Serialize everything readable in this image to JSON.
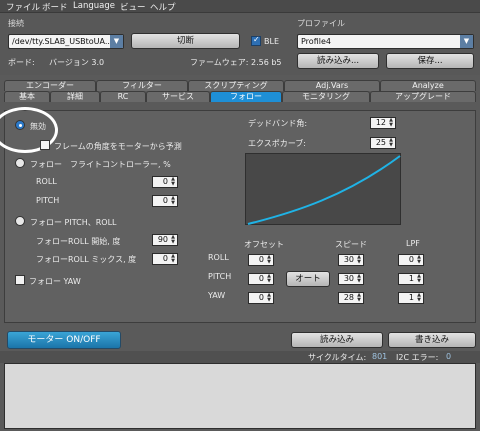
{
  "menu": [
    "ファイル",
    "ボード",
    "Language",
    "ビュー",
    "ヘルプ"
  ],
  "connection": {
    "group_label": "接続",
    "port_value": "/dev/tty.SLAB_USBtoUA...",
    "disconnect_label": "切断",
    "ble_label": "BLE",
    "board_label": "ボード:",
    "version_label": "バージョン 3.0",
    "firmware_label": "ファームウェア: 2.56 b5"
  },
  "profile": {
    "group_label": "プロファイル",
    "selected": "Profile4",
    "load_label": "読み込み...",
    "save_label": "保存..."
  },
  "tabs_row1": [
    "エンコーダー",
    "フィルター",
    "スクリプティング",
    "Adj.Vars",
    "Analyze"
  ],
  "tabs_row2": [
    "基本",
    "詳細",
    "RC",
    "サービス",
    "フォロー",
    "モニタリング",
    "アップグレード"
  ],
  "follow": {
    "disabled_label": "無効",
    "predict_label": "フレームの角度をモーターから予測",
    "fc_label": "フォロー　フライトコントローラー, %",
    "roll_label": "ROLL",
    "pitch_label": "PITCH",
    "roll_value": "0",
    "pitch_value": "0",
    "pitch_roll_label": "フォロー PITCH、ROLL",
    "roll_start_label": "フォローROLL 開始, 度",
    "roll_start_value": "90",
    "roll_mix_label": "フォローROLL ミックス, 度",
    "roll_mix_value": "0",
    "yaw_label": "フォロー YAW",
    "deadband_label": "デッドバンド角:",
    "deadband_value": "12",
    "expo_label": "エクスポカーブ:",
    "expo_value": "25",
    "offset_header": "オフセット",
    "speed_header": "スピード",
    "lpf_header": "LPF",
    "axis_roll": "ROLL",
    "axis_pitch": "PITCH",
    "axis_yaw": "YAW",
    "offset_roll": "0",
    "offset_pitch": "0",
    "offset_yaw": "0",
    "speed_roll": "30",
    "speed_pitch": "30",
    "speed_yaw": "28",
    "lpf_roll": "0",
    "lpf_pitch": "1",
    "lpf_yaw": "1",
    "auto_label": "オート"
  },
  "bottom": {
    "motor_label": "モーター ON/OFF",
    "read_label": "読み込み",
    "write_label": "書き込み",
    "cycle_label": "サイクルタイム:",
    "cycle_value": "801",
    "i2c_label": "I2C エラー:",
    "i2c_value": "0"
  },
  "colors": {
    "accent": "#1e8fd6",
    "curve": "#1fb3e6"
  }
}
